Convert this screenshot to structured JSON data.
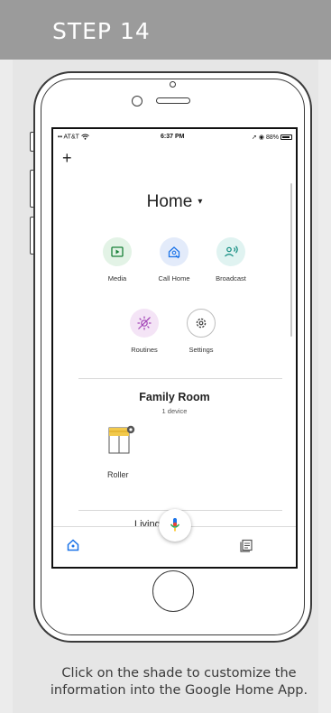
{
  "step": {
    "title": "STEP 14"
  },
  "status_bar": {
    "carrier": "AT&T",
    "time": "6:37 PM",
    "battery": "88%"
  },
  "top_bar": {
    "add_label": "+"
  },
  "home": {
    "title": "Home",
    "caret": "▾"
  },
  "actions": [
    {
      "label": "Media",
      "icon": "media-icon",
      "color": "#e3f3e6"
    },
    {
      "label": "Call Home",
      "icon": "call-home-icon",
      "color": "#e3ebfa"
    },
    {
      "label": "Broadcast",
      "icon": "broadcast-icon",
      "color": "#e0f3f1"
    },
    {
      "label": "Routines",
      "icon": "routines-icon",
      "color": "#f4e4f6"
    },
    {
      "label": "Settings",
      "icon": "settings-icon",
      "color": "#ffffff"
    }
  ],
  "room": {
    "title": "Family Room",
    "subtitle": "1 device"
  },
  "device": {
    "label": "Roller",
    "icon": "roller-shade-icon"
  },
  "next_room_peek": "Living room",
  "bottom_nav": {
    "home_icon": "home-icon",
    "feed_icon": "feed-icon"
  },
  "fab": {
    "icon": "microphone-icon"
  },
  "caption": "Click on the shade to customize the information into the Google Home App.",
  "colors": {
    "header_bg": "#9b9b9b",
    "panel_bg": "#e6e6e6",
    "accent_blue": "#1a73e8",
    "shade_yellow": "#f2c94c"
  }
}
